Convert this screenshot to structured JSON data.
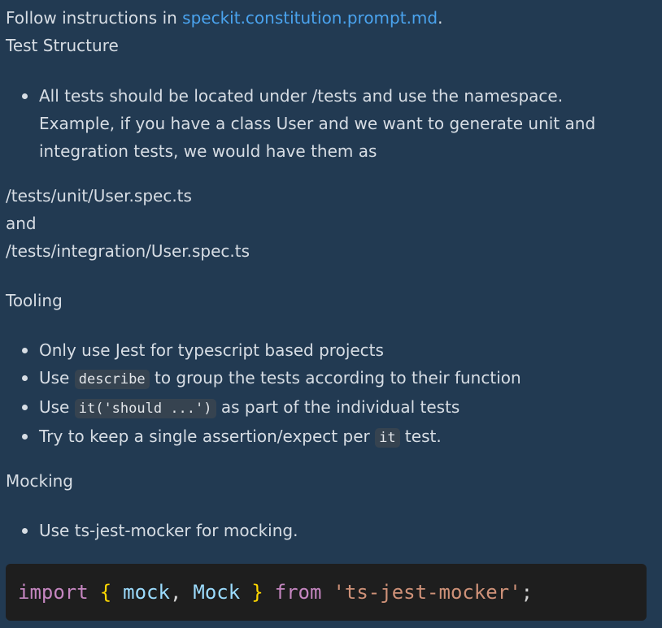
{
  "intro": {
    "prefix": "Follow instructions in ",
    "link_text": "speckit.constitution.prompt.md",
    "suffix": "."
  },
  "test_structure": {
    "heading": "Test Structure",
    "bullet_lines": [
      "All tests should be located under /tests and use the namespace.",
      "Example, if you have a class User and we want to generate unit and",
      "integration tests, we would have them as"
    ],
    "path_unit": "/tests/unit/User.spec.ts",
    "and_text": "and",
    "path_integration": "/tests/integration/User.spec.ts"
  },
  "tooling": {
    "heading": "Tooling",
    "item1": "Only use Jest for typescript based projects",
    "item2_pre": "Use ",
    "item2_code": "describe",
    "item2_post": " to group the tests according to their function",
    "item3_pre": "Use ",
    "item3_code": "it('should ...')",
    "item3_post": " as part of the individual tests",
    "item4_pre": "Try to keep a single assertion/expect per ",
    "item4_code": "it",
    "item4_post": " test."
  },
  "mocking": {
    "heading": "Mocking",
    "item1": "Use ts-jest-mocker for mocking."
  },
  "code": {
    "kw_import": "import",
    "brace_open": "{",
    "id_mock": "mock",
    "comma": ",",
    "id_Mock": "Mock",
    "brace_close": "}",
    "kw_from": "from",
    "string": "'ts-jest-mocker'",
    "semicolon": ";"
  },
  "colors": {
    "background": "#223a52",
    "link": "#4aa3ee",
    "code_background": "#1e1e1e"
  }
}
